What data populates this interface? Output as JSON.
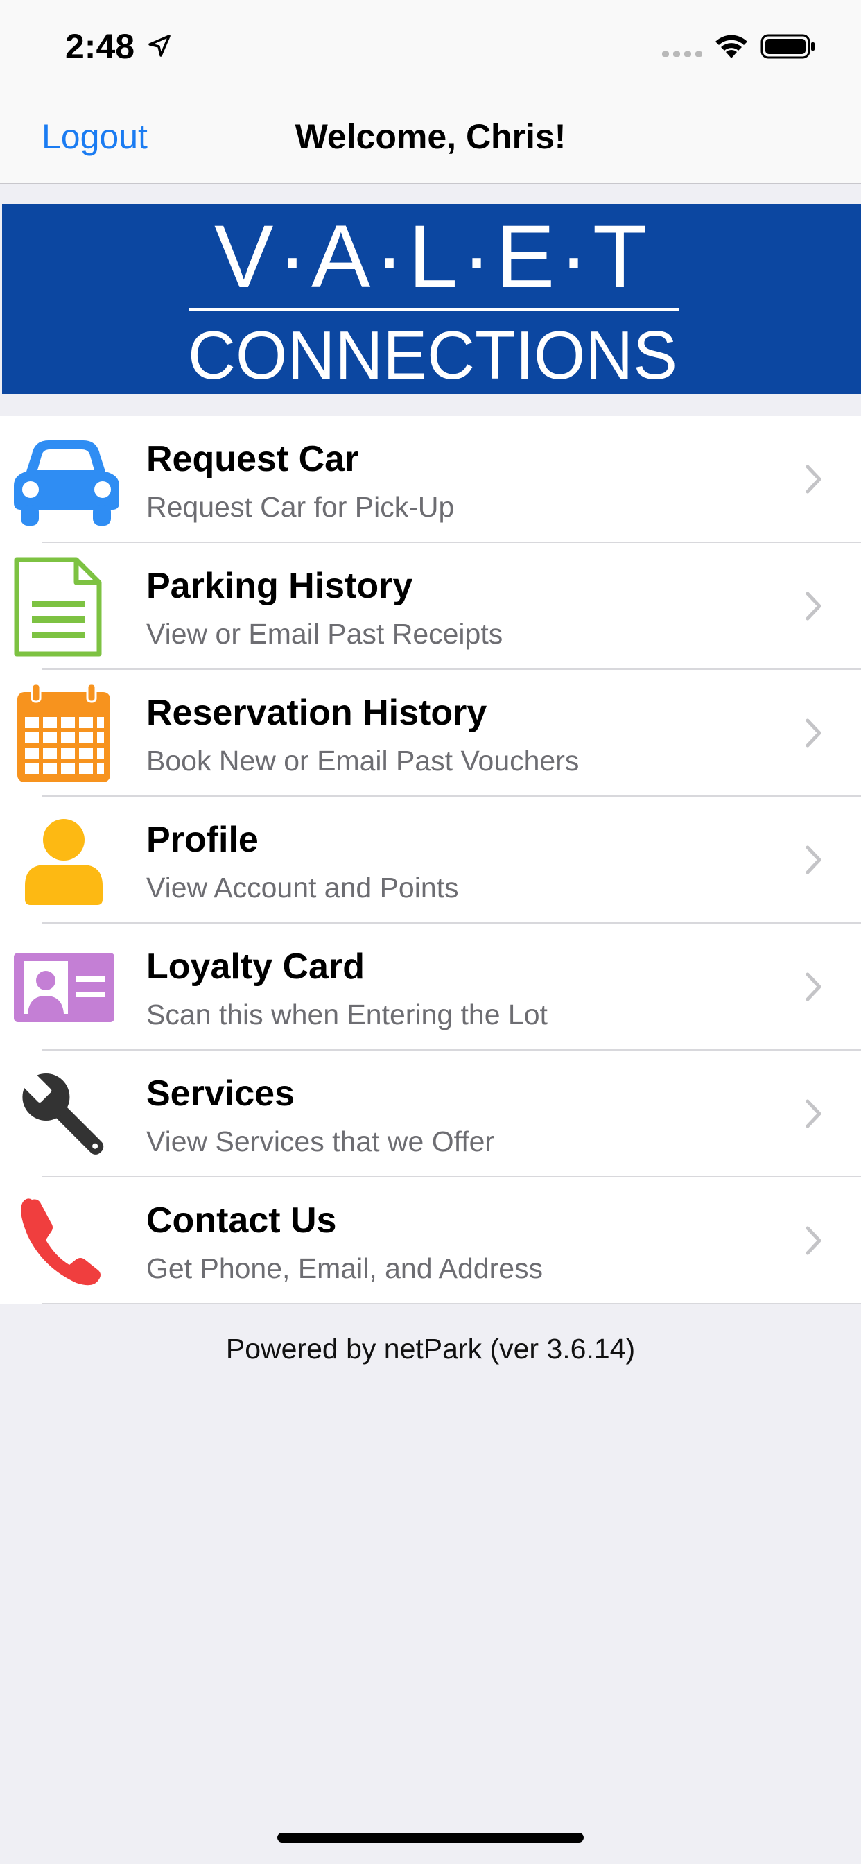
{
  "status_bar": {
    "time": "2:48"
  },
  "nav": {
    "logout_label": "Logout",
    "title": "Welcome, Chris!"
  },
  "banner": {
    "logo_top": "V·A·L·E·T",
    "logo_bottom": "CONNECTIONS"
  },
  "menu": {
    "items": [
      {
        "title": "Request Car",
        "subtitle": "Request Car for Pick-Up",
        "icon": "car-icon",
        "color": "#2f8df3"
      },
      {
        "title": "Parking History",
        "subtitle": "View or Email Past Receipts",
        "icon": "document-icon",
        "color": "#7dc242"
      },
      {
        "title": "Reservation History",
        "subtitle": "Book New or Email Past Vouchers",
        "icon": "calendar-icon",
        "color": "#f7931e"
      },
      {
        "title": "Profile",
        "subtitle": "View Account and Points",
        "icon": "person-icon",
        "color": "#fdb913"
      },
      {
        "title": "Loyalty Card",
        "subtitle": "Scan this when Entering the Lot",
        "icon": "id-card-icon",
        "color": "#c47fd5"
      },
      {
        "title": "Services",
        "subtitle": "View Services that we Offer",
        "icon": "wrench-icon",
        "color": "#333333"
      },
      {
        "title": "Contact Us",
        "subtitle": "Get Phone, Email, and Address",
        "icon": "phone-icon",
        "color": "#f03e3e"
      }
    ]
  },
  "footer": {
    "text": "Powered by netPark (ver 3.6.14)"
  }
}
